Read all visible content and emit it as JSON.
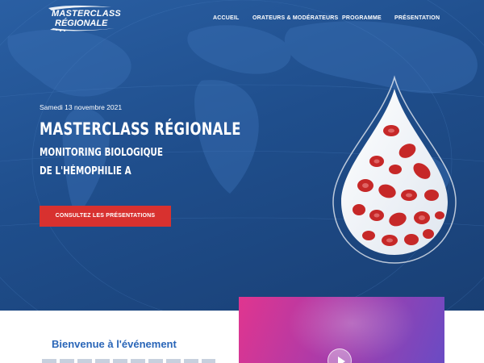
{
  "logo": {
    "line1": "MASTERCLASS",
    "line2": "RÉGIONALE"
  },
  "nav": {
    "items": [
      {
        "label": "ACCUEIL"
      },
      {
        "label": "ORATEURS & MODÉRATEURS"
      },
      {
        "label": "PROGRAMME"
      },
      {
        "label": "PRÉSENTATION"
      }
    ]
  },
  "hero": {
    "date": "Samedi 13 novembre 2021",
    "title_line1": "MASTERCLASS RÉGIONALE",
    "title_line2": "MONITORING BIOLOGIQUE",
    "title_line3": "DE L'HÉMOPHILIE A",
    "cta_label": "CONSULTEZ LES PRÉSENTATIONS"
  },
  "welcome": {
    "heading": "Bienvenue à l'événement"
  },
  "colors": {
    "hero_bg": "#1f4e8c",
    "cta_red": "#d8312f",
    "heading_blue": "#2a66b8",
    "blood_red": "#c62828"
  },
  "icons": {
    "video_play": "play-icon",
    "hero_graphic": "blood-drop-icon"
  }
}
